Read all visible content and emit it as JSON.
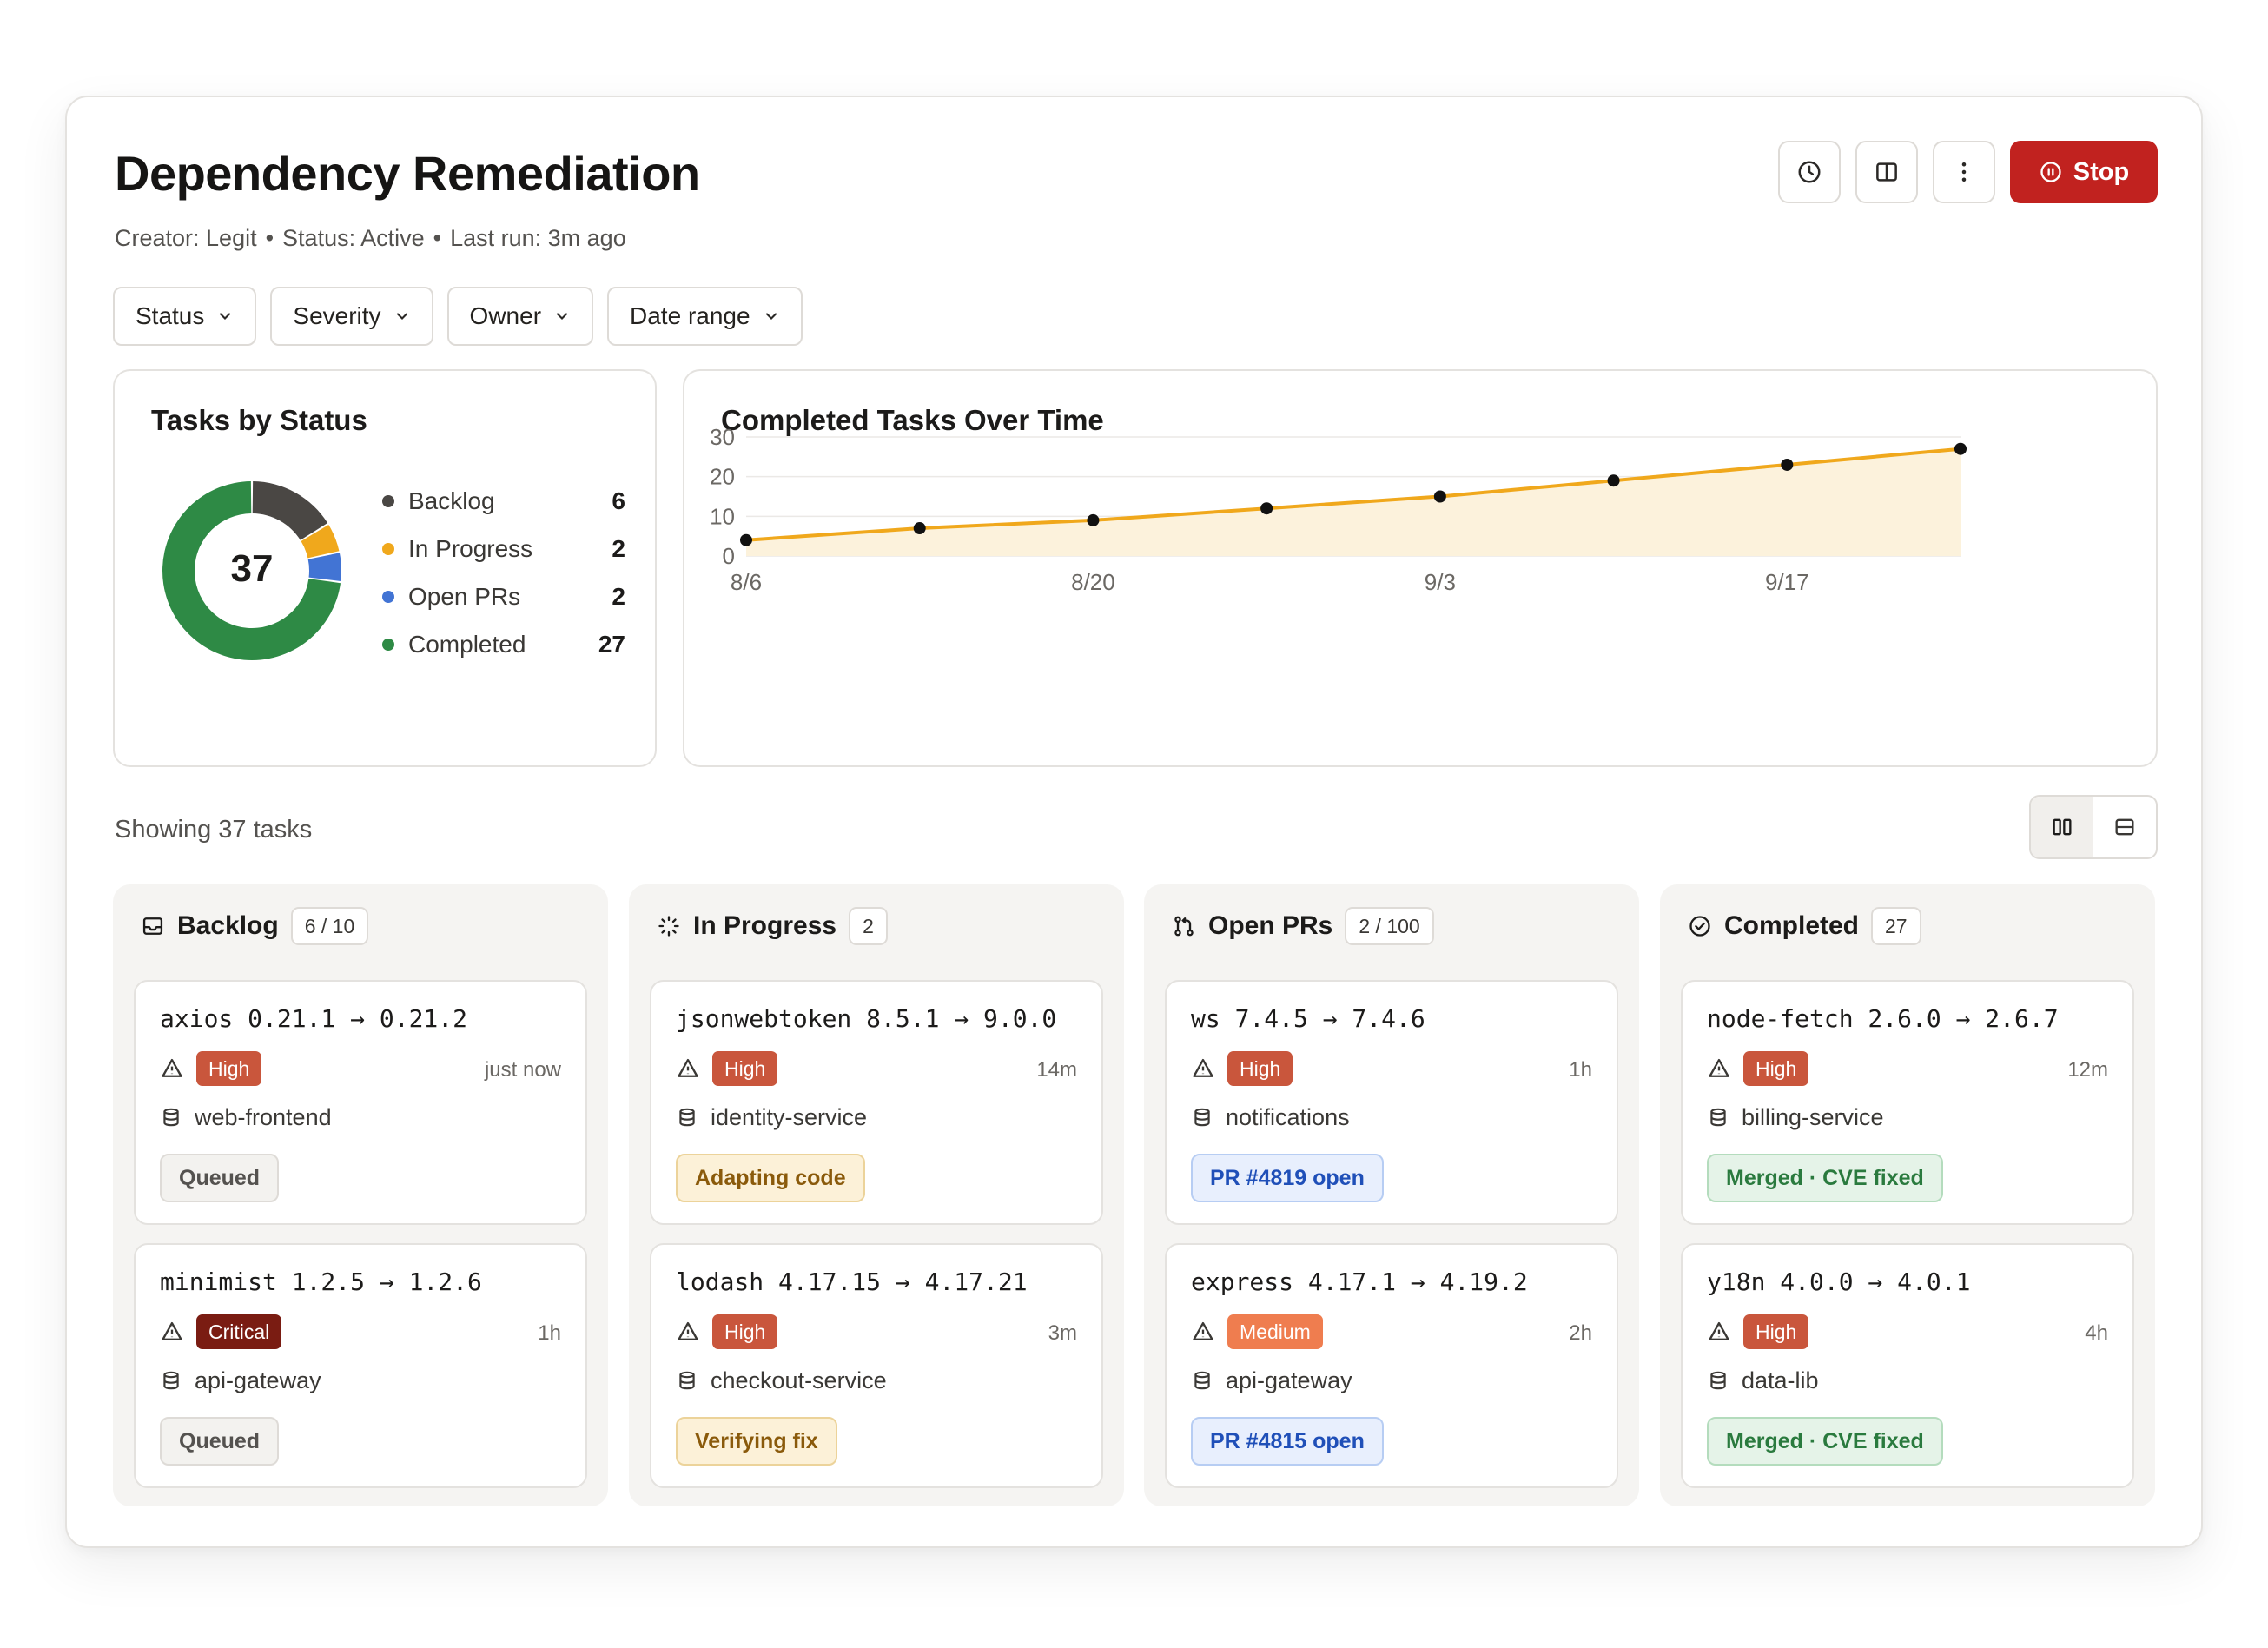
{
  "header": {
    "title": "Dependency Remediation",
    "meta": {
      "creator": "Creator: Legit",
      "status": "Status: Active",
      "last_run": "Last run: 3m ago",
      "separator": "•"
    },
    "actions": {
      "history_icon": "clock-icon",
      "layout_icon": "split-view-icon",
      "more_icon": "more-vertical-icon",
      "stop_label": "Stop",
      "stop_color": "#c1221f"
    }
  },
  "filters": [
    {
      "label": "Status"
    },
    {
      "label": "Severity"
    },
    {
      "label": "Owner"
    },
    {
      "label": "Date range"
    }
  ],
  "tasks_by_status": {
    "title": "Tasks by Status",
    "total": "37",
    "chart_data": {
      "type": "pie",
      "donut": true,
      "slices": [
        {
          "label": "Backlog",
          "value": 6,
          "color": "#4a4744"
        },
        {
          "label": "In Progress",
          "value": 2,
          "color": "#f0a81c"
        },
        {
          "label": "Open PRs",
          "value": 2,
          "color": "#4274d4"
        },
        {
          "label": "Completed",
          "value": 27,
          "color": "#2e8a45"
        }
      ],
      "center_label": "37",
      "legend_position": "right"
    },
    "legend": [
      {
        "label": "Backlog",
        "value": "6"
      },
      {
        "label": "In Progress",
        "value": "2"
      },
      {
        "label": "Open PRs",
        "value": "2"
      },
      {
        "label": "Completed",
        "value": "27"
      }
    ]
  },
  "completed_over_time": {
    "title": "Completed Tasks Over Time",
    "chart_data": {
      "type": "area",
      "x": [
        "8/6",
        "8/13",
        "8/20",
        "8/27",
        "9/3",
        "9/10",
        "9/17",
        "9/24"
      ],
      "values": [
        4,
        7,
        9,
        12,
        15,
        19,
        23,
        27
      ],
      "x_tick_labels": [
        "8/6",
        "8/20",
        "9/3",
        "9/17"
      ],
      "y_ticks": [
        "0",
        "10",
        "20",
        "30"
      ],
      "ylim": [
        0,
        30
      ],
      "grid": true,
      "line_color": "#f0a81c",
      "fill_color": "#fcf2dc",
      "marker_color": "#111111"
    }
  },
  "summary": {
    "showing": "Showing 37 tasks",
    "view_board_icon": "board-view-icon",
    "view_list_icon": "list-view-icon"
  },
  "columns": [
    {
      "name": "Backlog",
      "count": "6 / 10",
      "icon": "inbox-icon",
      "tasks": [
        {
          "title": "axios 0.21.1 → 0.21.2",
          "severity": "High",
          "sev_color": "#c9563c",
          "time": "just now",
          "repo": "web-frontend",
          "state": "Queued",
          "state_kind": "queued"
        },
        {
          "title": "minimist 1.2.5 → 1.2.6",
          "severity": "Critical",
          "sev_color": "#7a1c12",
          "time": "1h",
          "repo": "api-gateway",
          "state": "Queued",
          "state_kind": "queued"
        }
      ]
    },
    {
      "name": "In Progress",
      "count": "2",
      "icon": "loader-icon",
      "tasks": [
        {
          "title": "jsonwebtoken 8.5.1 → 9.0.0",
          "severity": "High",
          "sev_color": "#c9563c",
          "time": "14m",
          "repo": "identity-service",
          "state": "Adapting code",
          "state_kind": "progress"
        },
        {
          "title": "lodash 4.17.15 → 4.17.21",
          "severity": "High",
          "sev_color": "#c9563c",
          "time": "3m",
          "repo": "checkout-service",
          "state": "Verifying fix",
          "state_kind": "progress"
        }
      ]
    },
    {
      "name": "Open PRs",
      "count": "2 / 100",
      "icon": "git-pull-request-icon",
      "tasks": [
        {
          "title": "ws 7.4.5 → 7.4.6",
          "severity": "High",
          "sev_color": "#c9563c",
          "time": "1h",
          "repo": "notifications",
          "state": "PR #4819 open",
          "state_kind": "pr"
        },
        {
          "title": "express 4.17.1 → 4.19.2",
          "severity": "Medium",
          "sev_color": "#ef7d4f",
          "time": "2h",
          "repo": "api-gateway",
          "state": "PR #4815 open",
          "state_kind": "pr"
        }
      ]
    },
    {
      "name": "Completed",
      "count": "27",
      "icon": "check-circle-icon",
      "tasks": [
        {
          "title": "node-fetch 2.6.0 → 2.6.7",
          "severity": "High",
          "sev_color": "#c9563c",
          "time": "12m",
          "repo": "billing-service",
          "state": "Merged · CVE fixed",
          "state_kind": "done"
        },
        {
          "title": "y18n 4.0.0 → 4.0.1",
          "severity": "High",
          "sev_color": "#c9563c",
          "time": "4h",
          "repo": "data-lib",
          "state": "Merged · CVE fixed",
          "state_kind": "done"
        }
      ]
    }
  ]
}
